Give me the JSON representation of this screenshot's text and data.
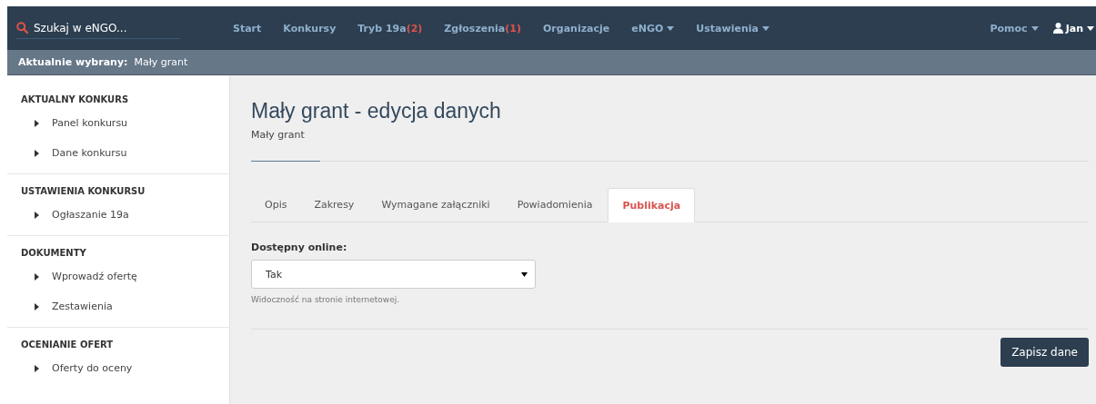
{
  "navbar": {
    "search": {
      "placeholder": "Szukaj w eNGO..."
    },
    "items": [
      {
        "label": "Start",
        "kind": "link"
      },
      {
        "label": "Konkursy",
        "kind": "link"
      },
      {
        "label": "Tryb 19a",
        "count": "(2)",
        "kind": "link"
      },
      {
        "label": "Zgłoszenia",
        "count": "(1)",
        "kind": "link"
      },
      {
        "label": "Organizacje",
        "kind": "link"
      },
      {
        "label": "eNGO",
        "kind": "dropdown"
      },
      {
        "label": "Ustawienia",
        "kind": "dropdown"
      }
    ],
    "right_items": [
      {
        "label": "Pomoc",
        "kind": "dropdown"
      },
      {
        "label": "Jan",
        "kind": "user"
      }
    ]
  },
  "context_bar": {
    "label": "Aktualnie wybrany:",
    "value": "Mały grant"
  },
  "sidebar": {
    "sections": [
      {
        "heading": "AKTUALNY KONKURS",
        "items": [
          "Panel konkursu",
          "Dane konkursu"
        ]
      },
      {
        "heading": "USTAWIENIA KONKURSU",
        "items": [
          "Ogłaszanie 19a"
        ]
      },
      {
        "heading": "DOKUMENTY",
        "items": [
          "Wprowadź ofertę",
          "Zestawienia"
        ]
      },
      {
        "heading": "OCENIANIE OFERT",
        "items": [
          "Oferty do oceny"
        ]
      }
    ]
  },
  "page": {
    "title": "Mały grant - edycja danych",
    "subtitle": "Mały grant",
    "tabs": [
      {
        "label": "Opis",
        "selected": false
      },
      {
        "label": "Zakresy",
        "selected": false
      },
      {
        "label": "Wymagane załączniki",
        "selected": false
      },
      {
        "label": "Powiadomienia",
        "selected": false
      },
      {
        "label": "Publikacja",
        "selected": true
      }
    ],
    "field": {
      "label": "Dostępny online:",
      "value": "Tak",
      "help": "Widoczność na stronie internetowej."
    },
    "save_button": "Zapisz dane"
  }
}
